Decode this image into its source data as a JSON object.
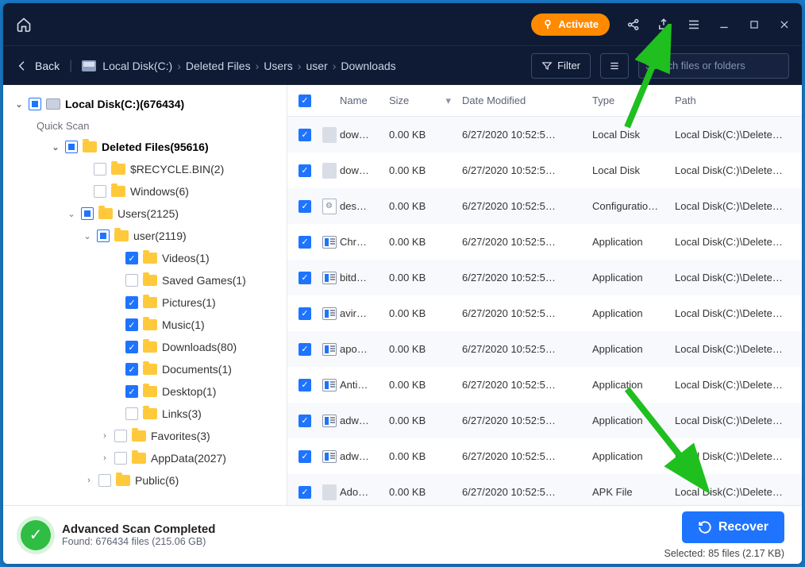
{
  "titlebar": {
    "activate": "Activate"
  },
  "toolbar": {
    "back": "Back",
    "crumbs": [
      "Local Disk(C:)",
      "Deleted Files",
      "Users",
      "user",
      "Downloads"
    ],
    "filter": "Filter",
    "search_placeholder": "Search files or folders"
  },
  "tree": {
    "root": "Local Disk(C:)(676434)",
    "quick": "Quick Scan",
    "nodes": [
      {
        "pad": 46,
        "chev": "v",
        "box": "mixed",
        "label": "Deleted Files(95616)",
        "bold": true,
        "icon": "folder"
      },
      {
        "pad": 82,
        "chev": "",
        "box": "empty",
        "label": "$RECYCLE.BIN(2)",
        "icon": "folder"
      },
      {
        "pad": 82,
        "chev": "",
        "box": "empty",
        "label": "Windows(6)",
        "icon": "folder"
      },
      {
        "pad": 66,
        "chev": "v",
        "box": "mixed",
        "label": "Users(2125)",
        "icon": "folder"
      },
      {
        "pad": 86,
        "chev": "v",
        "box": "mixed",
        "label": "user(2119)",
        "icon": "folder"
      },
      {
        "pad": 122,
        "chev": "",
        "box": "checked",
        "label": "Videos(1)",
        "icon": "folder"
      },
      {
        "pad": 122,
        "chev": "",
        "box": "empty",
        "label": "Saved Games(1)",
        "icon": "folder"
      },
      {
        "pad": 122,
        "chev": "",
        "box": "checked",
        "label": "Pictures(1)",
        "icon": "folder"
      },
      {
        "pad": 122,
        "chev": "",
        "box": "checked",
        "label": "Music(1)",
        "icon": "folder"
      },
      {
        "pad": 122,
        "chev": "",
        "box": "checked",
        "label": "Downloads(80)",
        "icon": "folder"
      },
      {
        "pad": 122,
        "chev": "",
        "box": "checked",
        "label": "Documents(1)",
        "icon": "folder"
      },
      {
        "pad": 122,
        "chev": "",
        "box": "checked",
        "label": "Desktop(1)",
        "icon": "folder"
      },
      {
        "pad": 122,
        "chev": "",
        "box": "empty",
        "label": "Links(3)",
        "icon": "folder"
      },
      {
        "pad": 108,
        "chev": ">",
        "box": "empty",
        "label": "Favorites(3)",
        "icon": "folder"
      },
      {
        "pad": 108,
        "chev": ">",
        "box": "empty",
        "label": "AppData(2027)",
        "icon": "folder"
      },
      {
        "pad": 88,
        "chev": ">",
        "box": "empty",
        "label": "Public(6)",
        "icon": "folder"
      }
    ]
  },
  "columns": {
    "name": "Name",
    "size": "Size",
    "date": "Date Modified",
    "type": "Type",
    "path": "Path"
  },
  "rows": [
    {
      "ic": "file",
      "name": "dow…",
      "size": "0.00 KB",
      "date": "6/27/2020 10:52:5…",
      "type": "Local Disk",
      "path": "Local Disk(C:)\\Delete…"
    },
    {
      "ic": "file",
      "name": "dow…",
      "size": "0.00 KB",
      "date": "6/27/2020 10:52:5…",
      "type": "Local Disk",
      "path": "Local Disk(C:)\\Delete…"
    },
    {
      "ic": "cfg",
      "name": "des…",
      "size": "0.00 KB",
      "date": "6/27/2020 10:52:5…",
      "type": "Configuratio…",
      "path": "Local Disk(C:)\\Delete…"
    },
    {
      "ic": "app",
      "name": "Chr…",
      "size": "0.00 KB",
      "date": "6/27/2020 10:52:5…",
      "type": "Application",
      "path": "Local Disk(C:)\\Delete…"
    },
    {
      "ic": "app",
      "name": "bitd…",
      "size": "0.00 KB",
      "date": "6/27/2020 10:52:5…",
      "type": "Application",
      "path": "Local Disk(C:)\\Delete…"
    },
    {
      "ic": "app",
      "name": "avir…",
      "size": "0.00 KB",
      "date": "6/27/2020 10:52:5…",
      "type": "Application",
      "path": "Local Disk(C:)\\Delete…"
    },
    {
      "ic": "app",
      "name": "apo…",
      "size": "0.00 KB",
      "date": "6/27/2020 10:52:5…",
      "type": "Application",
      "path": "Local Disk(C:)\\Delete…"
    },
    {
      "ic": "app",
      "name": "Anti…",
      "size": "0.00 KB",
      "date": "6/27/2020 10:52:5…",
      "type": "Application",
      "path": "Local Disk(C:)\\Delete…"
    },
    {
      "ic": "app",
      "name": "adw…",
      "size": "0.00 KB",
      "date": "6/27/2020 10:52:5…",
      "type": "Application",
      "path": "Local Disk(C:)\\Delete…"
    },
    {
      "ic": "app",
      "name": "adw…",
      "size": "0.00 KB",
      "date": "6/27/2020 10:52:5…",
      "type": "Application",
      "path": "Local Disk(C:)\\Delete…"
    },
    {
      "ic": "file",
      "name": "Ado…",
      "size": "0.00 KB",
      "date": "6/27/2020 10:52:5…",
      "type": "APK File",
      "path": "Local Disk(C:)\\Delete…"
    }
  ],
  "footer": {
    "title": "Advanced Scan Completed",
    "sub": "Found: 676434 files (215.06 GB)",
    "recover": "Recover",
    "selected": "Selected: 85 files (2.17 KB)"
  }
}
